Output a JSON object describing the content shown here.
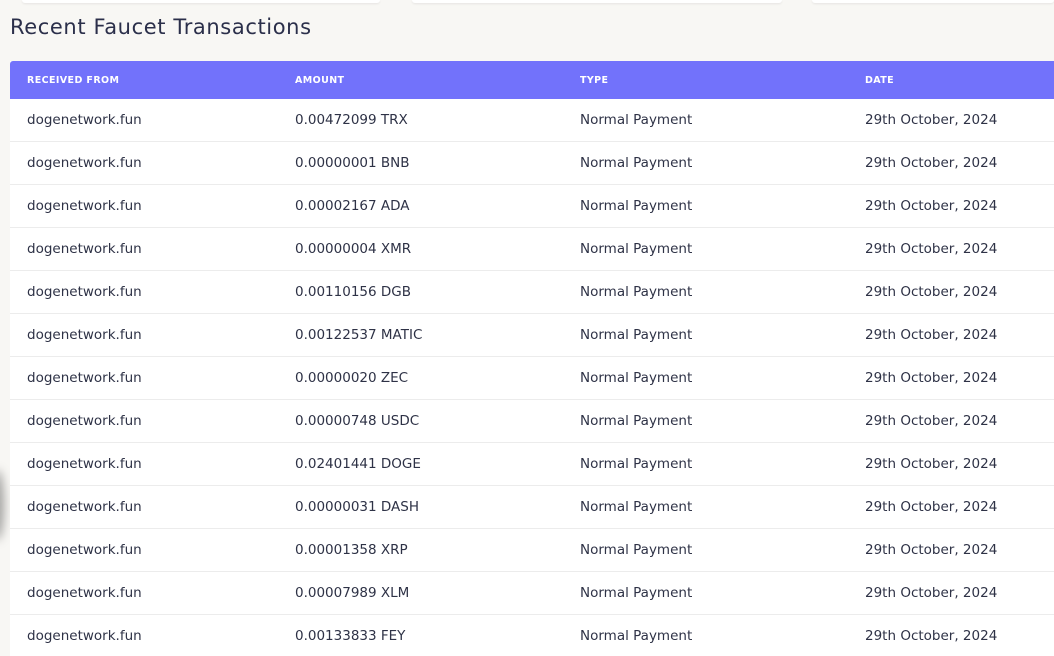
{
  "section": {
    "title": "Recent Faucet Transactions"
  },
  "table": {
    "headers": [
      "RECEIVED FROM",
      "AMOUNT",
      "TYPE",
      "DATE"
    ],
    "rows": [
      {
        "from": "dogenetwork.fun",
        "amount": "0.00472099 TRX",
        "type": "Normal Payment",
        "date": "29th October, 2024"
      },
      {
        "from": "dogenetwork.fun",
        "amount": "0.00000001 BNB",
        "type": "Normal Payment",
        "date": "29th October, 2024"
      },
      {
        "from": "dogenetwork.fun",
        "amount": "0.00002167 ADA",
        "type": "Normal Payment",
        "date": "29th October, 2024"
      },
      {
        "from": "dogenetwork.fun",
        "amount": "0.00000004 XMR",
        "type": "Normal Payment",
        "date": "29th October, 2024"
      },
      {
        "from": "dogenetwork.fun",
        "amount": "0.00110156 DGB",
        "type": "Normal Payment",
        "date": "29th October, 2024"
      },
      {
        "from": "dogenetwork.fun",
        "amount": "0.00122537 MATIC",
        "type": "Normal Payment",
        "date": "29th October, 2024"
      },
      {
        "from": "dogenetwork.fun",
        "amount": "0.00000020 ZEC",
        "type": "Normal Payment",
        "date": "29th October, 2024"
      },
      {
        "from": "dogenetwork.fun",
        "amount": "0.00000748 USDC",
        "type": "Normal Payment",
        "date": "29th October, 2024"
      },
      {
        "from": "dogenetwork.fun",
        "amount": "0.02401441 DOGE",
        "type": "Normal Payment",
        "date": "29th October, 2024"
      },
      {
        "from": "dogenetwork.fun",
        "amount": "0.00000031 DASH",
        "type": "Normal Payment",
        "date": "29th October, 2024"
      },
      {
        "from": "dogenetwork.fun",
        "amount": "0.00001358 XRP",
        "type": "Normal Payment",
        "date": "29th October, 2024"
      },
      {
        "from": "dogenetwork.fun",
        "amount": "0.00007989 XLM",
        "type": "Normal Payment",
        "date": "29th October, 2024"
      },
      {
        "from": "dogenetwork.fun",
        "amount": "0.00133833 FEY",
        "type": "Normal Payment",
        "date": "29th October, 2024"
      }
    ]
  },
  "colors": {
    "header_bg": "#7272fb",
    "page_bg": "#f8f7f4",
    "text": "#2e3246"
  }
}
